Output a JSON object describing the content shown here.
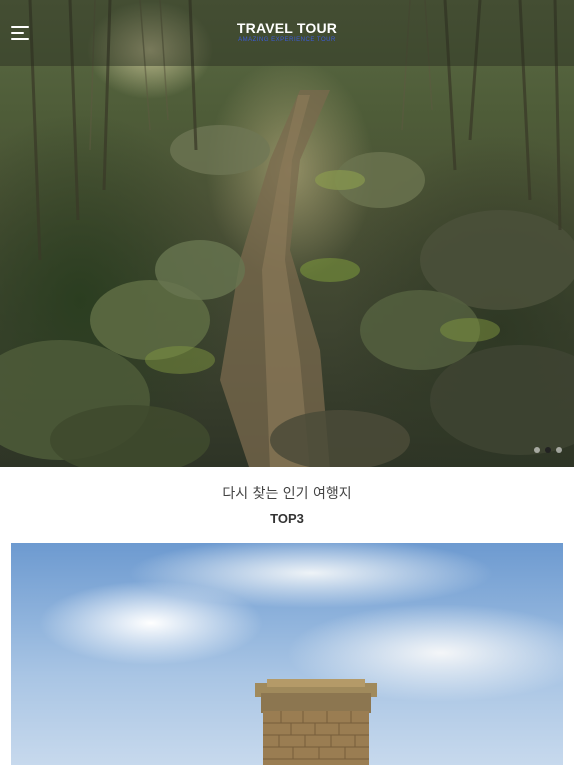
{
  "header": {
    "title": "TRAVEL TOUR",
    "subtitle": "AMAZING EXPERIENCE TOUR"
  },
  "icons": {
    "menu": "hamburger-menu-icon"
  },
  "hero": {
    "image": "forest-path-photo",
    "slides": 3,
    "active_slide": 2
  },
  "section": {
    "title": "다시 찾는 인기 여행지",
    "subtitle": "TOP3"
  },
  "card": {
    "image": "stone-tower-sky-photo"
  },
  "colors": {
    "brand_subtitle": "#3b5bd8",
    "text_dark": "#333333"
  }
}
